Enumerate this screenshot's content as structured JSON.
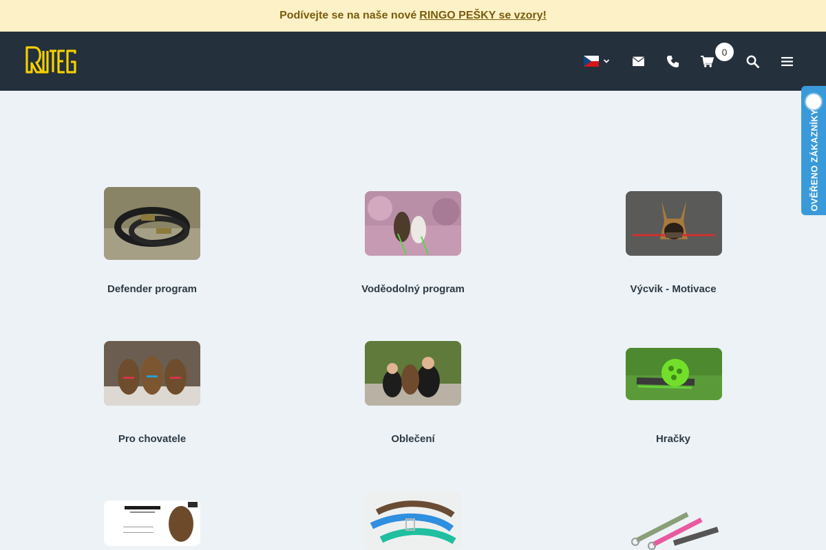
{
  "promo": {
    "text": "Podívejte se na naše nové",
    "link": "RINGO PEŠKY se vzory!"
  },
  "header": {
    "logo_alt": "ROTEGA",
    "cart_count": "0",
    "icons": {
      "language": "czech-flag-icon",
      "mail": "envelope-icon",
      "phone": "phone-icon",
      "cart": "shopping-cart-icon",
      "search": "search-icon",
      "menu": "hamburger-menu-icon"
    }
  },
  "trust_badge": {
    "label": "OVĚŘENO ZÁKAZNÍKY"
  },
  "categories": [
    {
      "label": "Defender program"
    },
    {
      "label": "Voděodolný program"
    },
    {
      "label": "Výcvik - Motivace"
    },
    {
      "label": "Pro chovatele"
    },
    {
      "label": "Oblečení"
    },
    {
      "label": "Hračky"
    },
    {
      "label": ""
    },
    {
      "label": ""
    },
    {
      "label": ""
    }
  ],
  "colors": {
    "promo_bg": "#fdf1c7",
    "header_bg": "#24303b",
    "logo": "#f5d000",
    "page_bg": "#ecf2f5",
    "trust_badge": "#3a9ad9"
  }
}
